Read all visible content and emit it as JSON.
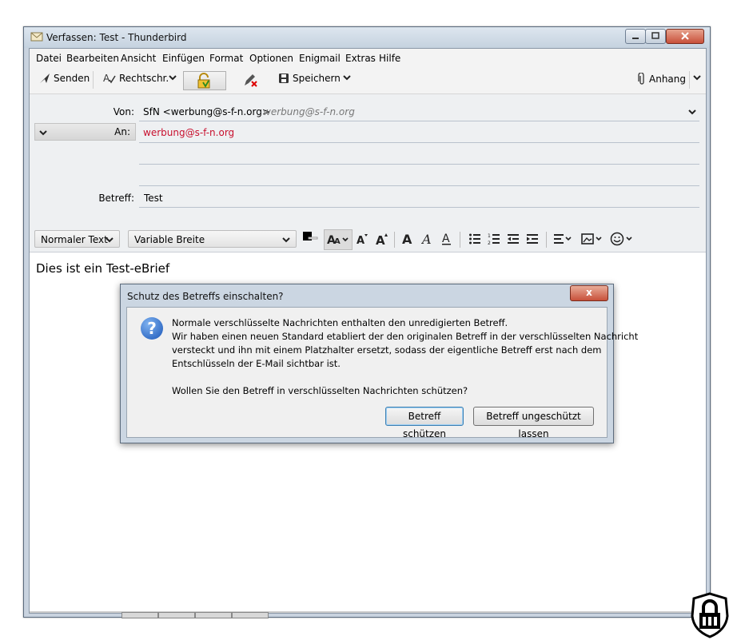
{
  "window": {
    "title": "Verfassen: Test - Thunderbird"
  },
  "menu": [
    "Datei",
    "Bearbeiten",
    "Ansicht",
    "Einfügen",
    "Format",
    "Optionen",
    "Enigmail",
    "Extras",
    "Hilfe"
  ],
  "toolbar": {
    "send_label": "Senden",
    "spell_label": "Rechtschr.",
    "save_label": "Speichern",
    "attach_label": "Anhang"
  },
  "headers": {
    "from_label": "Von:",
    "from_value": "SfN <werbung@s-f-n.org>",
    "from_hint": "werbung@s-f-n.org",
    "to_label": "An:",
    "to_value": "werbung@s-f-n.org",
    "subject_label": "Betreff:",
    "subject_value": "Test"
  },
  "format": {
    "paragraph_style": "Normaler Text",
    "font": "Variable Breite"
  },
  "body": {
    "text": "Dies ist ein Test-eBrief"
  },
  "dialog": {
    "title": "Schutz des Betreffs einschalten?",
    "close_label": "x",
    "lines": [
      "Normale verschlüsselte Nachrichten enthalten den unredigierten Betreff.",
      "Wir haben einen neuen Standard etabliert der den originalen Betreff in der verschlüsselten Nachricht",
      "versteckt und ihn mit einem Platzhalter ersetzt, sodass der eigentliche Betreff erst nach dem",
      "Entschlüsseln der E-Mail sichtbar ist."
    ],
    "question": "Wollen Sie den Betreff in verschlüsselten Nachrichten schützen?",
    "btn_protect": "Betreff schützen",
    "btn_unprotect": "Betreff ungeschützt lassen"
  },
  "colors": {
    "recipient": "#c8102e",
    "accent": "#1a56b8"
  }
}
